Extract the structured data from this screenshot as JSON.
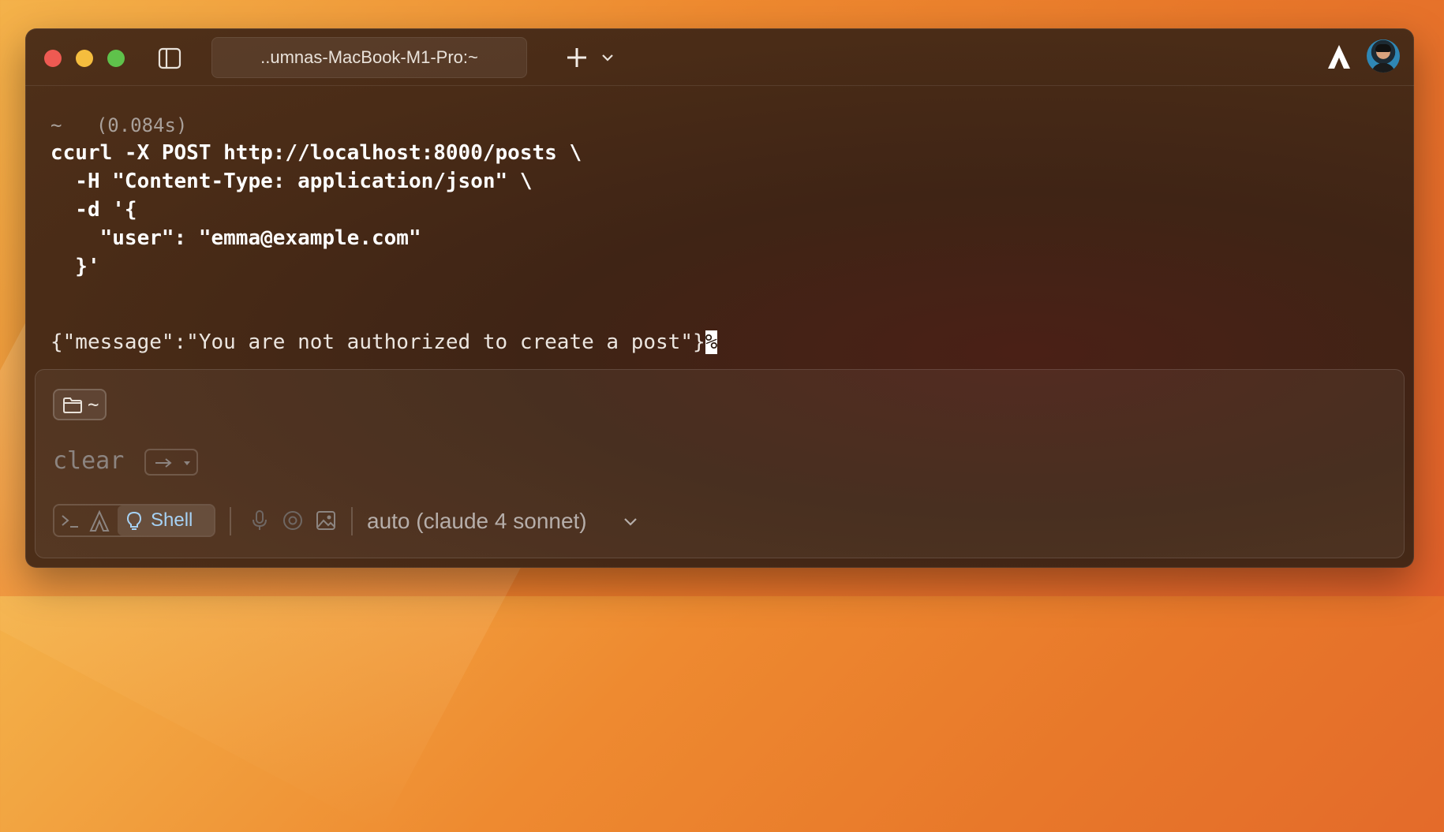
{
  "window": {
    "tab_title": "..umnas-MacBook-M1-Pro:~",
    "icons": {
      "sidebar_toggle": "sidebar-icon",
      "new_tab": "plus-icon",
      "tab_menu": "chevron-down-icon",
      "agent": "warp-agent-icon",
      "avatar": "user-avatar"
    }
  },
  "terminal": {
    "prompt_dir": "~",
    "duration": "(0.084s)",
    "command_lines": [
      "ccurl -X POST http://localhost:8000/posts \\",
      "  -H \"Content-Type: application/json\" \\",
      "  -d '{",
      "    \"user\": \"emma@example.com\"",
      "  }'"
    ],
    "output": "{\"message\":\"You are not authorized to create a post\"}",
    "output_cursor": "%"
  },
  "input": {
    "directory_chip": "~",
    "value": "clear",
    "modes": {
      "shell_label": "Shell"
    },
    "model": "auto (claude 4 sonnet)"
  },
  "colors": {
    "accent_shell": "#a6d2f5",
    "traffic_red": "#ee5a52",
    "traffic_yellow": "#f5bd3e",
    "traffic_green": "#5fc24b"
  }
}
